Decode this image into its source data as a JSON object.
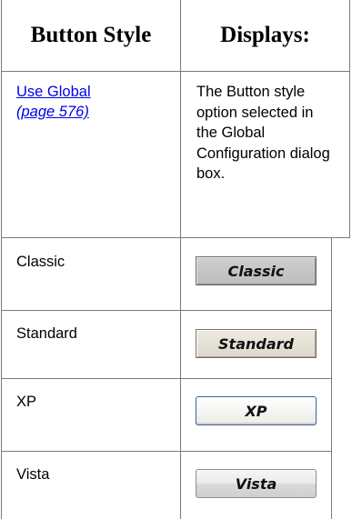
{
  "table": {
    "headers": [
      "Button Style",
      "Displays:"
    ],
    "row_use_global": {
      "link_text": "Use Global",
      "page_ref": "(page 576)",
      "description": "The Button style option selected in the Global Configuration dialog box."
    },
    "rows": [
      {
        "style": "Classic",
        "button_label": "Classic"
      },
      {
        "style": "Standard",
        "button_label": "Standard"
      },
      {
        "style": "XP",
        "button_label": "XP"
      },
      {
        "style": "Vista",
        "button_label": "Vista"
      }
    ]
  },
  "colors": {
    "border": "#7a7a7a",
    "link": "#0000ee"
  }
}
